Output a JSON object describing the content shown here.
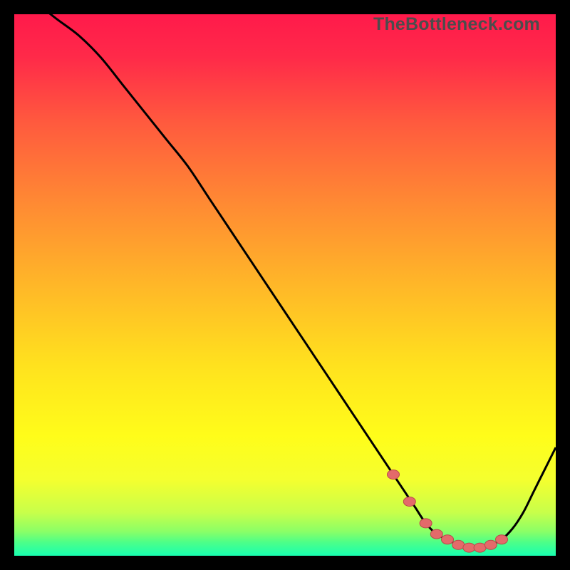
{
  "watermark": "TheBottleneck.com",
  "colors": {
    "background": "#000000",
    "gradient_stops": [
      {
        "offset": 0.0,
        "color": "#ff1a4b"
      },
      {
        "offset": 0.08,
        "color": "#ff2a49"
      },
      {
        "offset": 0.2,
        "color": "#ff5a3e"
      },
      {
        "offset": 0.35,
        "color": "#ff8a33"
      },
      {
        "offset": 0.5,
        "color": "#ffb728"
      },
      {
        "offset": 0.65,
        "color": "#ffe21e"
      },
      {
        "offset": 0.78,
        "color": "#fffd1a"
      },
      {
        "offset": 0.86,
        "color": "#f4ff2f"
      },
      {
        "offset": 0.92,
        "color": "#c8ff4a"
      },
      {
        "offset": 0.955,
        "color": "#8bff66"
      },
      {
        "offset": 0.975,
        "color": "#4dff88"
      },
      {
        "offset": 1.0,
        "color": "#18ffb0"
      }
    ],
    "curve": "#000000",
    "marker_fill": "#e46a6a",
    "marker_stroke": "#b94a4a"
  },
  "chart_data": {
    "type": "line",
    "title": "",
    "xlabel": "",
    "ylabel": "",
    "xlim": [
      0,
      100
    ],
    "ylim": [
      0,
      100
    ],
    "series": [
      {
        "name": "bottleneck-curve",
        "x": [
          0,
          4,
          8,
          12,
          16,
          20,
          24,
          28,
          32,
          36,
          40,
          44,
          48,
          52,
          56,
          60,
          64,
          68,
          70,
          72,
          74,
          76,
          78,
          80,
          82,
          84,
          86,
          88,
          90,
          92,
          94,
          96,
          98,
          100
        ],
        "y": [
          104,
          102,
          99,
          96,
          92,
          87,
          82,
          77,
          72,
          66,
          60,
          54,
          48,
          42,
          36,
          30,
          24,
          18,
          15,
          12,
          9,
          6,
          4,
          3,
          2,
          1.5,
          1.5,
          2,
          3,
          5,
          8,
          12,
          16,
          20
        ]
      }
    ],
    "markers": {
      "name": "optimal-range-markers",
      "x": [
        70,
        73,
        76,
        78,
        80,
        82,
        84,
        86,
        88,
        90
      ],
      "y": [
        15,
        10,
        6,
        4,
        3,
        2,
        1.5,
        1.5,
        2,
        3
      ]
    }
  }
}
